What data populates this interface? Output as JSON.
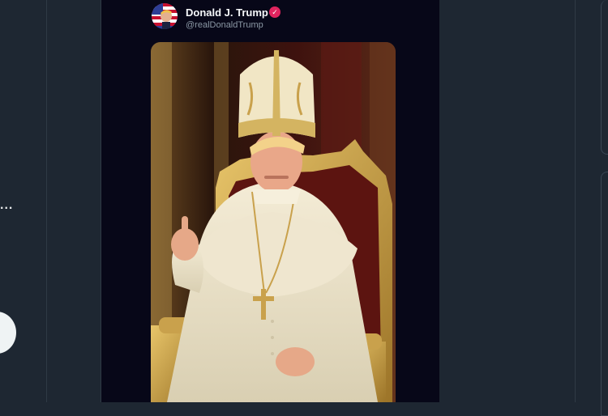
{
  "post": {
    "display_name": "Donald J. Trump",
    "handle": "@realDonaldTrump",
    "verified": true,
    "avatar_icon": "flag-portrait-avatar",
    "media_icon": "pope-portrait-image"
  },
  "nav": {
    "more_label": "..."
  },
  "colors": {
    "background": "#1e2732",
    "card": "#070718",
    "name_text": "#f5f7f9",
    "handle_text": "#8b98a5",
    "badge": "#e0245e"
  }
}
